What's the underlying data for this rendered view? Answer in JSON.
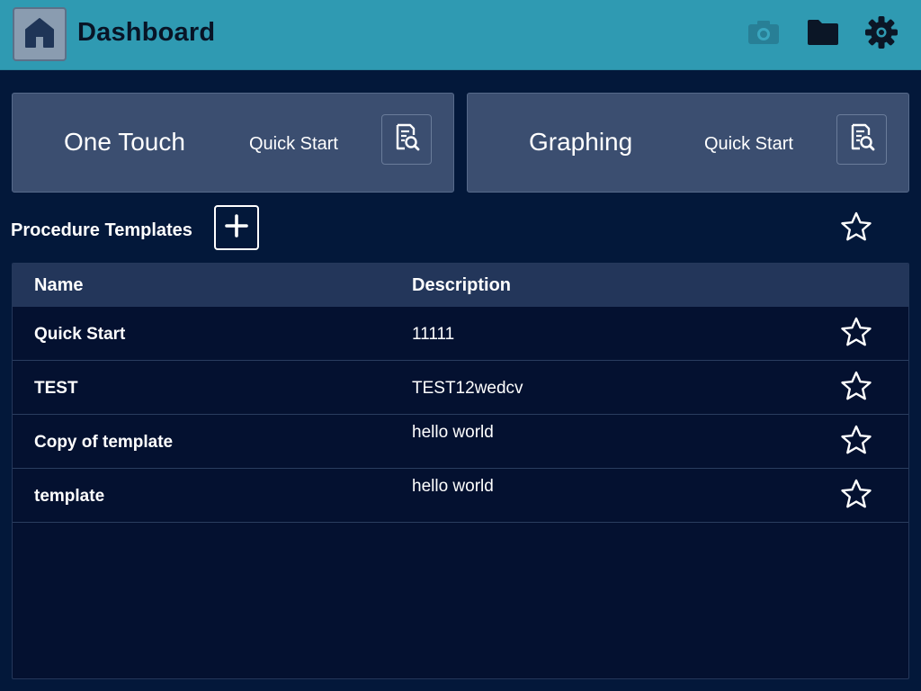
{
  "header": {
    "title": "Dashboard",
    "icons": {
      "home": "home-icon",
      "camera": "camera-icon",
      "folder": "folder-icon",
      "settings": "gear-icon"
    },
    "colors": {
      "bar": "#2f9ab2",
      "title": "#081426"
    }
  },
  "quick_start": {
    "cards": [
      {
        "title": "One Touch",
        "subtitle": "Quick Start",
        "icon": "document-search-icon"
      },
      {
        "title": "Graphing",
        "subtitle": "Quick Start",
        "icon": "document-search-icon"
      }
    ]
  },
  "templates": {
    "title": "Procedure Templates",
    "add_icon": "plus-icon",
    "favorite_filter_icon": "star-outline-icon",
    "columns": [
      "Name",
      "Description"
    ],
    "rows": [
      {
        "name": "Quick Start",
        "description": "11111"
      },
      {
        "name": "TEST",
        "description": "TEST12wedcv"
      },
      {
        "name": "Copy of template",
        "description": "hello world"
      },
      {
        "name": "template",
        "description": "hello world"
      }
    ]
  },
  "colors": {
    "background": "#03183a",
    "card": "#3b4e70",
    "table_header": "#23365a"
  }
}
